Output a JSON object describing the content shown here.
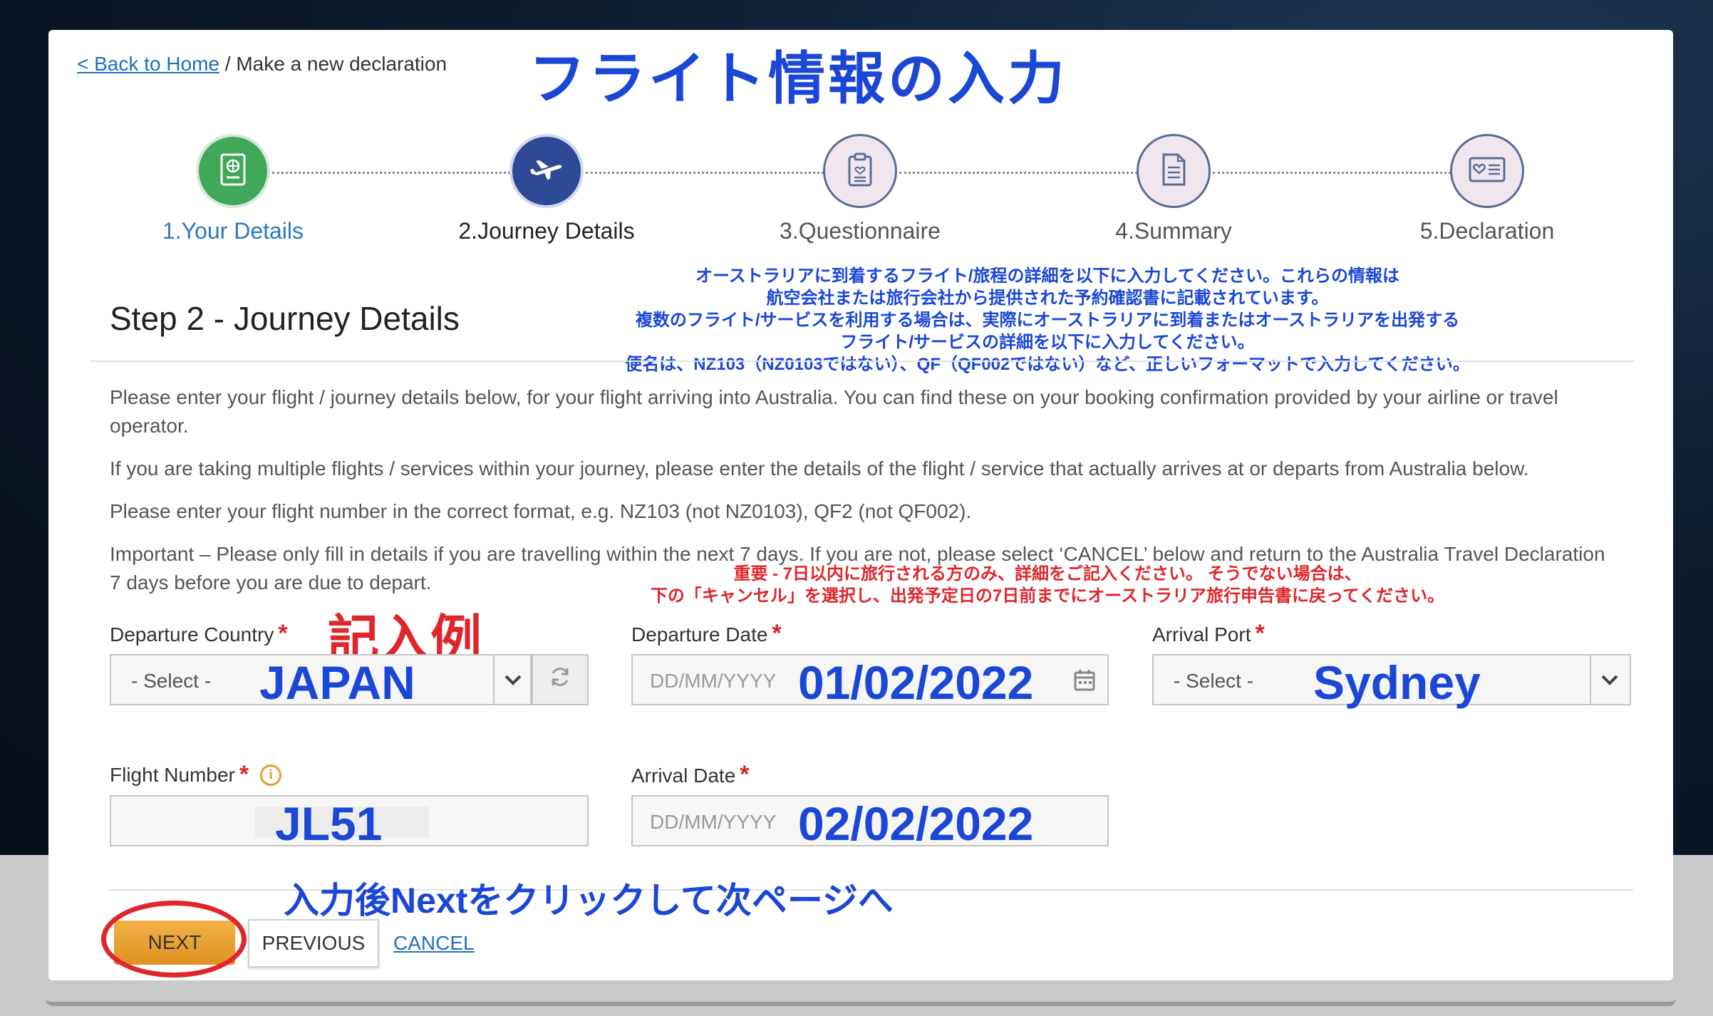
{
  "breadcrumb": {
    "back_link": "< Back to Home",
    "separator": " / ",
    "current": "Make a new declaration"
  },
  "annotation_title": "フライト情報の入力",
  "steps": [
    {
      "label": "1.Your Details",
      "icon": "passport-icon",
      "state": "done"
    },
    {
      "label": "2.Journey Details",
      "icon": "airplane-icon",
      "state": "current"
    },
    {
      "label": "3.Questionnaire",
      "icon": "clipboard-icon",
      "state": "todo"
    },
    {
      "label": "4.Summary",
      "icon": "document-icon",
      "state": "todo"
    },
    {
      "label": "5.Declaration",
      "icon": "card-heart-icon",
      "state": "todo"
    }
  ],
  "step_heading": "Step 2 - Journey Details",
  "annotation_note": [
    "オーストラリアに到着するフライト/旅程の詳細を以下に入力してください。これらの情報は",
    "航空会社または旅行会社から提供された予約確認書に記載されています。",
    "複数のフライト/サービスを利用する場合は、実際にオーストラリアに到着またはオーストラリアを出発する",
    "フライト/サービスの詳細を以下に入力してください。",
    "便名は、NZ103（NZ0103ではない）、QF（QF002ではない）など、正しいフォーマットで入力してください。"
  ],
  "paragraphs": [
    "Please enter your flight / journey details below, for your flight arriving into Australia. You can find these on your booking confirmation provided by your airline or travel operator.",
    "If you are taking multiple flights / services within your journey, please enter the details of the flight / service that actually arrives at or departs from Australia below.",
    "Please enter your flight number in the correct format, e.g. NZ103 (not NZ0103), QF2 (not QF002).",
    "Important – Please only fill in details if you are travelling within the next 7 days.  If you are not, please select ‘CANCEL’ below and return to the Australia Travel Declaration 7 days before you are due to depart."
  ],
  "annotation_important": [
    "重要 - 7日以内に旅行される方のみ、詳細をご記入ください。 そうでない場合は、",
    "下の「キャンセル」を選択し、出発予定日の7日前までにオーストラリア旅行申告書に戻ってください。"
  ],
  "annotation_example": "記入例",
  "fields": {
    "departure_country": {
      "label": "Departure Country",
      "required": "*",
      "select_text": "- Select -",
      "example": "JAPAN"
    },
    "departure_date": {
      "label": "Departure Date",
      "required": "*",
      "placeholder": "DD/MM/YYYY",
      "example": "01/02/2022"
    },
    "arrival_port": {
      "label": "Arrival Port",
      "required": "*",
      "select_text": "- Select -",
      "example": "Sydney"
    },
    "flight_number": {
      "label": "Flight Number",
      "required": "*",
      "info": "i",
      "example": "JL51"
    },
    "arrival_date": {
      "label": "Arrival Date",
      "required": "*",
      "placeholder": "DD/MM/YYYY",
      "example": "02/02/2022"
    }
  },
  "annotation_next": "入力後Nextをクリックして次ページへ",
  "buttons": {
    "next": "NEXT",
    "previous": "PREVIOUS",
    "cancel": "CANCEL"
  }
}
